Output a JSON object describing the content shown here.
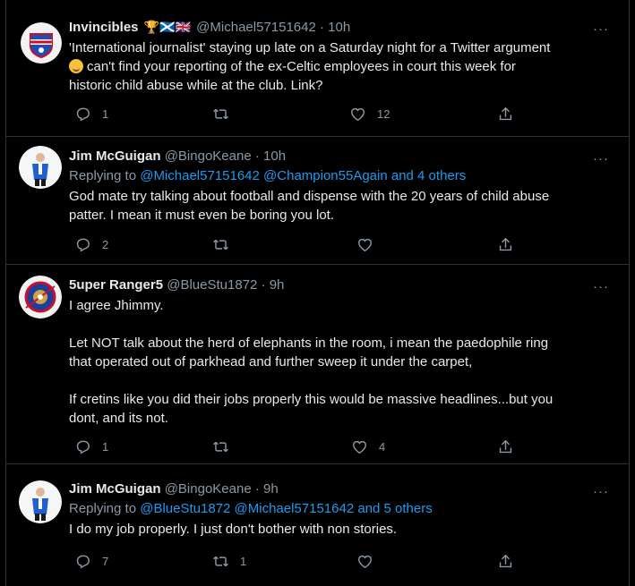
{
  "colors": {
    "background": "#000000",
    "text": "#e7e9ea",
    "secondary": "#8b98a5",
    "link": "#1d9bf0",
    "divider": "#2f3336"
  },
  "tweets": [
    {
      "name": "Invincibles",
      "badges": "🏆🏴󠁧󠁢󠁳󠁣󠁴󠁿🇬🇧",
      "handle": "@Michael57151642",
      "time": "10h",
      "reply_prefix": "",
      "reply_mentions": "",
      "text_line1": "'International journalist' staying up late on a Saturday night for a Twitter argument",
      "text_rest": "can't find your reporting of the ex-Celtic employees in court this week for\nhistoric child abuse while at the club. Link?",
      "replies": "1",
      "retweets": "",
      "likes": "12",
      "avatar_icon": "club-crest-avatar"
    },
    {
      "name": "Jim McGuigan",
      "handle": "@BingoKeane",
      "time": "10h",
      "reply_prefix": "Replying to",
      "reply_mentions": "@Michael57151642 @Champion55Again and 4 others",
      "text": "God mate try talking about football and dispense with the 20 years of child abuse\npatter. I mean it must even be boring you lot.",
      "replies": "2",
      "retweets": "",
      "likes": "",
      "avatar_icon": "person-avatar"
    },
    {
      "name": "5uper Ranger5",
      "handle": "@BlueStu1872",
      "time": "9h",
      "reply_prefix": "",
      "reply_mentions": "",
      "text": "I agree Jhimmy.\n\nLet NOT talk about the herd of elephants in the room, i mean the paedophile ring\nthat operated out of parkhead and further sweep it under the carpet,\n\nIf cretins like you did their jobs properly this would be massive headlines...but you\ndont, and its not.",
      "replies": "1",
      "retweets": "",
      "likes": "4",
      "avatar_icon": "club-badge-avatar"
    },
    {
      "name": "Jim McGuigan",
      "handle": "@BingoKeane",
      "time": "9h",
      "reply_prefix": "Replying to",
      "reply_mentions": "@BlueStu1872 @Michael57151642 and 5 others",
      "text": "I do my job properly. I just don't bother with non stories.",
      "replies": "7",
      "retweets": "1",
      "likes": "",
      "avatar_icon": "person-avatar"
    }
  ],
  "separator": "·",
  "more_label": "···"
}
